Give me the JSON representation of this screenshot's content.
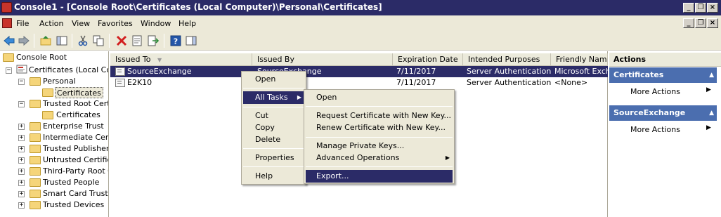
{
  "window": {
    "title": "Console1 - [Console Root\\Certificates (Local Computer)\\Personal\\Certificates]"
  },
  "menubar": [
    "File",
    "Action",
    "View",
    "Favorites",
    "Window",
    "Help"
  ],
  "tree": {
    "root": "Console Root",
    "certificates": "Certificates (Local Com",
    "personal": "Personal",
    "personal_certs": "Certificates",
    "trusted_root": "Trusted Root Certi",
    "trusted_root_certs": "Certificates",
    "enterprise_trust": "Enterprise Trust",
    "intermediate": "Intermediate Certif",
    "trusted_publishers": "Trusted Publishers",
    "untrusted": "Untrusted Certifica",
    "third_party": "Third-Party Root C",
    "trusted_people": "Trusted People",
    "smart_card": "Smart Card Trusted",
    "trusted_devices": "Trusted Devices"
  },
  "list": {
    "columns": [
      "Issued To",
      "Issued By",
      "Expiration Date",
      "Intended Purposes",
      "Friendly Name"
    ],
    "rows": [
      [
        "SourceExchange",
        "SourceExchange",
        "7/11/2017",
        "Server Authentication",
        "Microsoft Excha"
      ],
      [
        "E2K10",
        "",
        "7/11/2017",
        "Server Authentication",
        "<None>"
      ]
    ]
  },
  "actions": {
    "title": "Actions",
    "section1": "Certificates",
    "section1_item": "More Actions",
    "section2": "SourceExchange",
    "section2_item": "More Actions"
  },
  "context_menu": {
    "open": "Open",
    "all_tasks": "All Tasks",
    "cut": "Cut",
    "copy": "Copy",
    "delete": "Delete",
    "properties": "Properties",
    "help": "Help"
  },
  "submenu": {
    "open": "Open",
    "request_new_key": "Request Certificate with New Key...",
    "renew_new_key": "Renew Certificate with New Key...",
    "manage_private_keys": "Manage Private Keys...",
    "advanced_operations": "Advanced Operations",
    "export": "Export..."
  },
  "colors": {
    "title_bar": "#2b2b67",
    "selection": "#2b2b67",
    "action_header": "#4b6eaf",
    "chrome": "#ece9d8"
  }
}
